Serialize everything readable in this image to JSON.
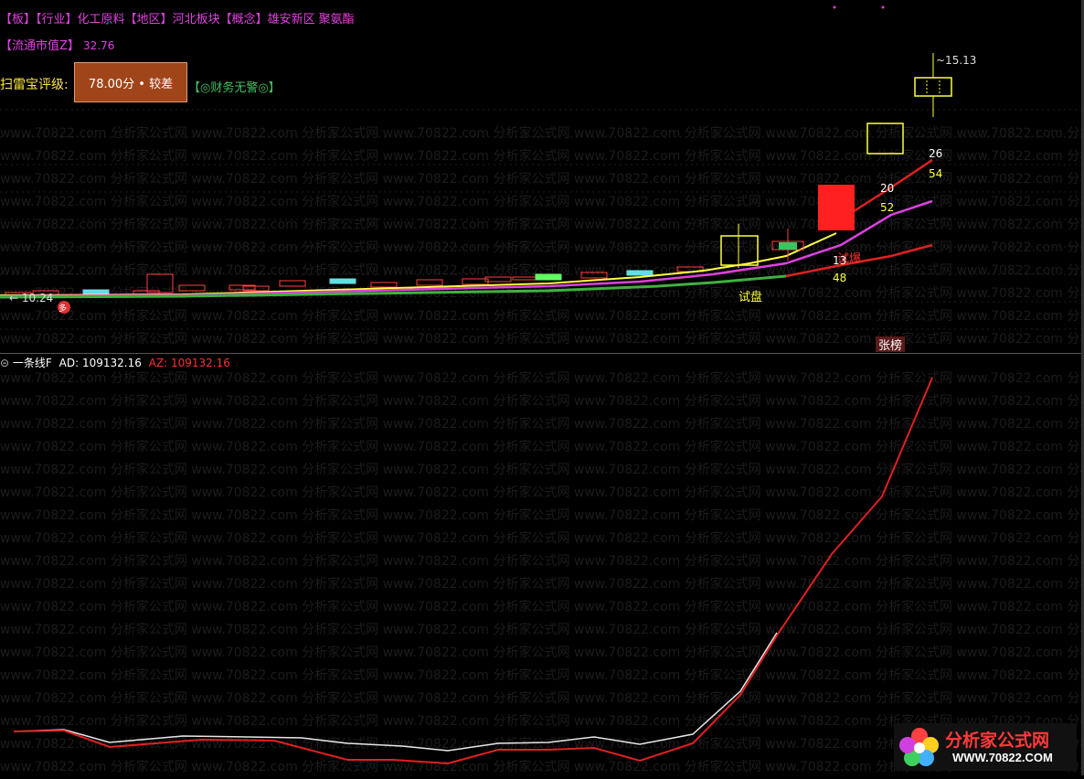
{
  "header": {
    "line1": [
      {
        "text": "【板】",
        "color": "#e040e0"
      },
      {
        "text": "【行业】",
        "color": "#e040e0"
      },
      {
        "text": "化工原料",
        "color": "#e040e0"
      },
      {
        "text": "【地区】",
        "color": "#e040e0"
      },
      {
        "text": "河北板块",
        "color": "#e040e0"
      },
      {
        "text": "【概念】",
        "color": "#e040e0"
      },
      {
        "text": "雄安新区",
        "color": "#e040e0"
      },
      {
        "text": "聚氨酯",
        "color": "#e040e0"
      }
    ],
    "market_cap_label": "【流通市值Z】",
    "market_cap_value": "32.76",
    "scan_label": "扫雷宝评级:",
    "score_text": "78.00分 • 较差",
    "finance_tag": "【◎财务无警◎】"
  },
  "top_chart": {
    "high_label": "~15.13",
    "low_label": "← 10.24",
    "trial_label": "试盘",
    "zhang_label": "张榜",
    "baofa_label": "试爆",
    "ma_labels": {
      "ma_a_top": "26",
      "ma_a_bot": "54",
      "ma_b_top": "20",
      "ma_b_bot": "52",
      "ma_c_top": "13",
      "ma_c_bot": "48"
    },
    "badge": "多"
  },
  "indicator": {
    "name": "一条线F",
    "ad_label": "AD:",
    "ad_value": "109132.16",
    "az_label": "AZ:",
    "az_value": "109132.16"
  },
  "watermark": "www.70822.com 分析家公式网",
  "logo": {
    "title": "分析家公式网",
    "url": "WWW.70822.COM"
  },
  "colors": {
    "background": "#000000",
    "up": "#ff2020",
    "down": "#40c060",
    "ma_yellow": "#ffff40",
    "ma_magenta": "#e040e0",
    "ma_red": "#e02020",
    "ma_green": "#40b040",
    "accent_tag": "#40c060"
  }
}
